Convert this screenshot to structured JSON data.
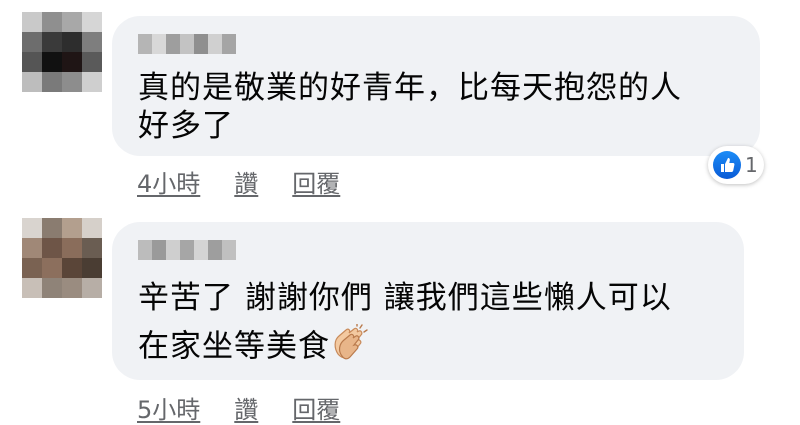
{
  "comments": [
    {
      "text_line1": "真的是敬業的好青年，比每天抱怨的人",
      "text_line2": "好多了",
      "time": "4小時",
      "like_label": "讚",
      "reply_label": "回覆",
      "reaction_count": "1",
      "reaction_icon": "thumbs-up-icon"
    },
    {
      "text_line1": "辛苦了 謝謝你們 讓我們這些懶人可以",
      "text_line2": "在家坐等美食",
      "emoji_icon": "clapping-hands-icon",
      "time": "5小時",
      "like_label": "讚",
      "reply_label": "回覆"
    }
  ],
  "colors": {
    "bubble": "#f0f2f5",
    "meta_text": "#65676b",
    "like_blue": "#1877f2"
  }
}
